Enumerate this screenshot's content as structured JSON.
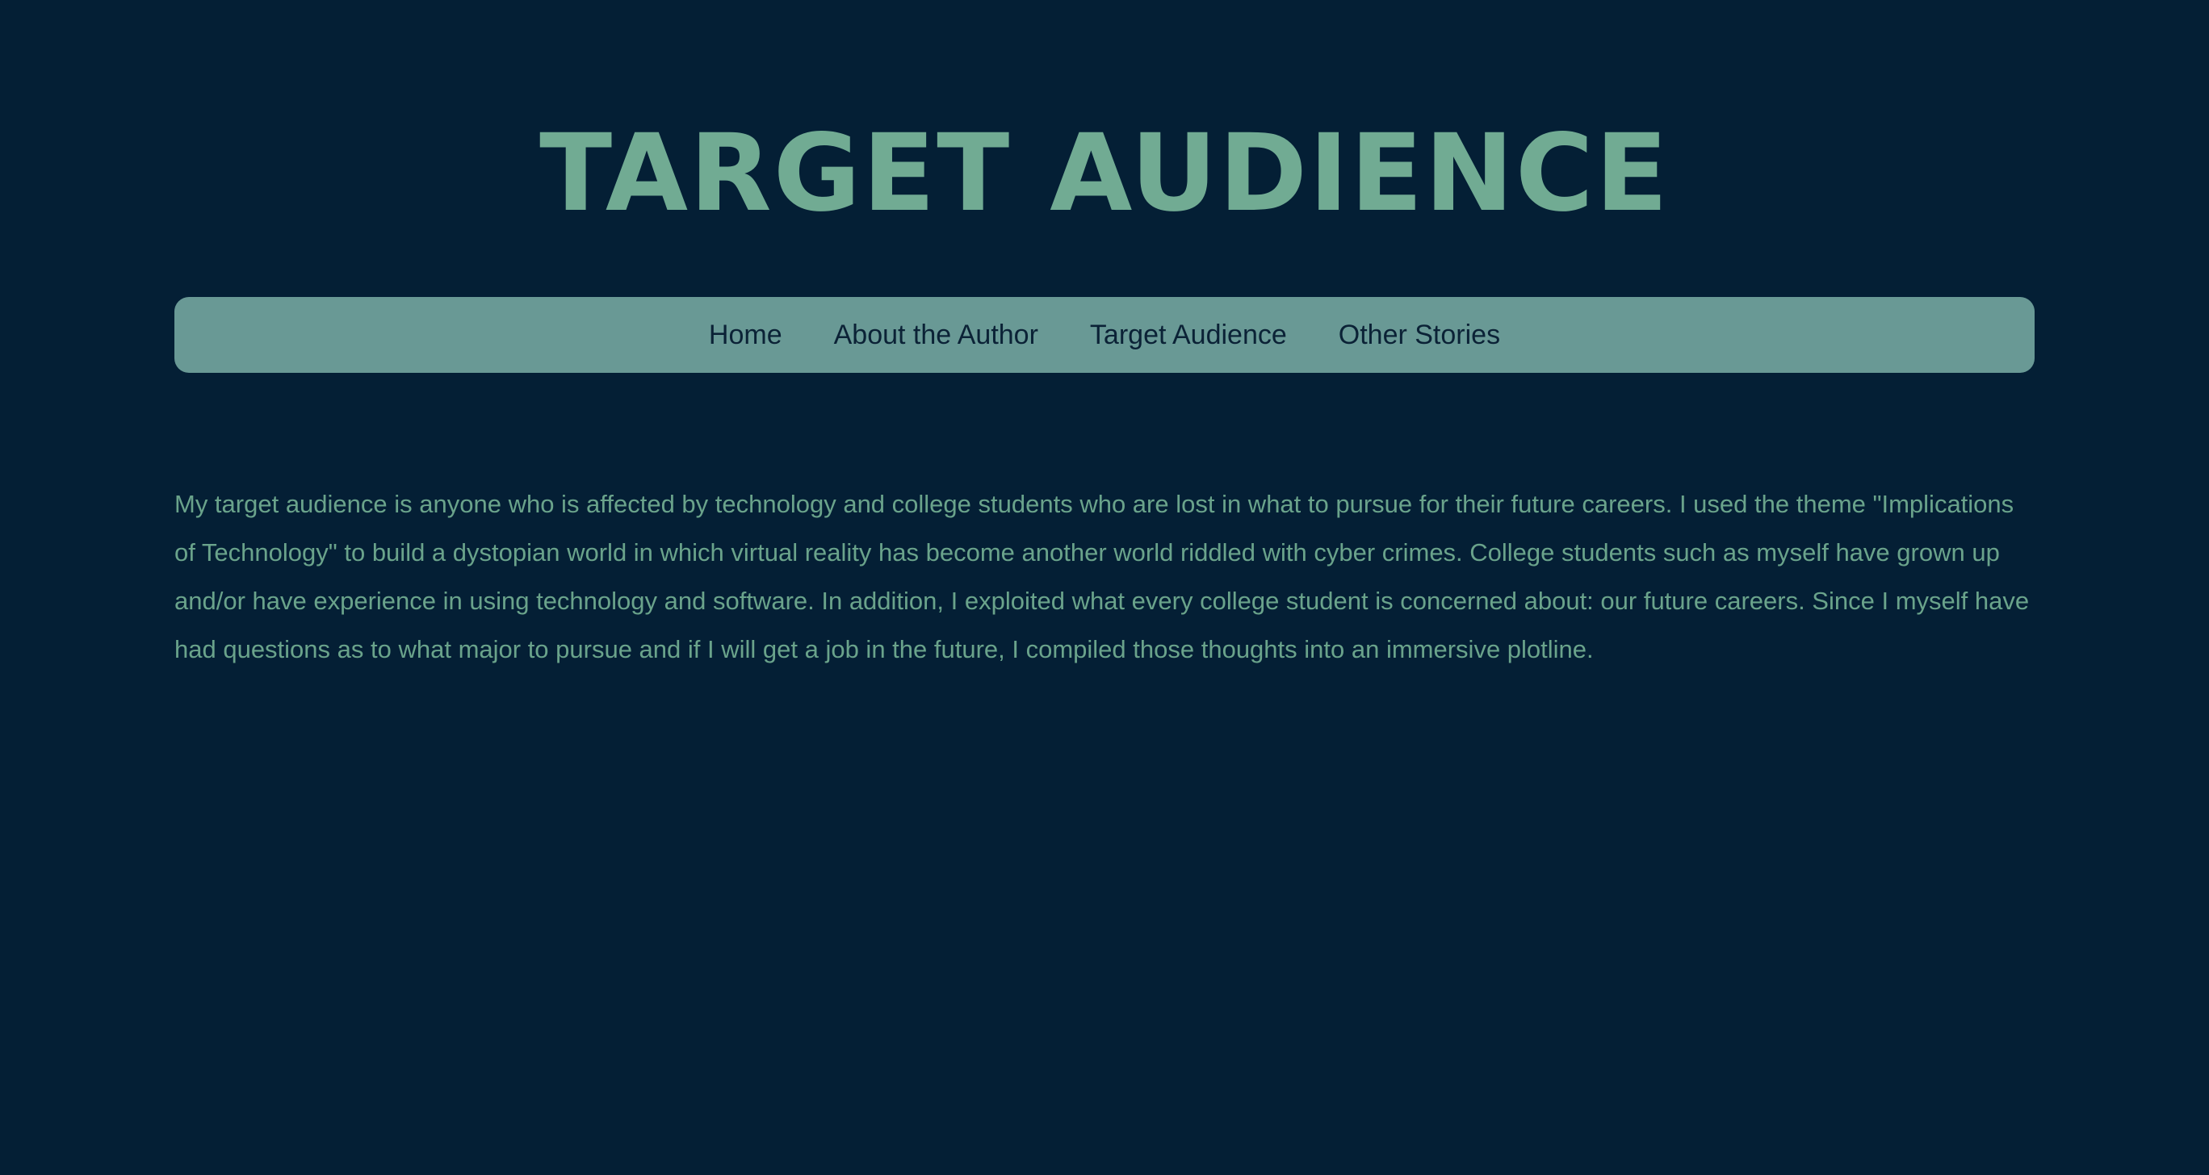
{
  "page": {
    "title": "TARGET AUDIENCE"
  },
  "nav": {
    "items": [
      {
        "label": "Home"
      },
      {
        "label": "About the Author"
      },
      {
        "label": "Target Audience"
      },
      {
        "label": "Other Stories"
      }
    ]
  },
  "content": {
    "paragraph": "My target audience is anyone who is affected by technology and college students who are lost in what to pursue for their future careers. I used the theme \"Implications of Technology\" to build a dystopian world in which virtual reality has become another world riddled with cyber crimes. College students such as myself have grown up and/or have experience in using technology and software. In addition, I exploited what every college student is concerned about: our future careers. Since I myself have had questions as to what major to pursue and if I will get a job in the future, I compiled those thoughts into an immersive plotline."
  },
  "colors": {
    "background": "#041f35",
    "accent": "#71ab93",
    "nav_background": "#699995",
    "nav_text": "#0b2236",
    "body_text": "#6aa38b"
  }
}
